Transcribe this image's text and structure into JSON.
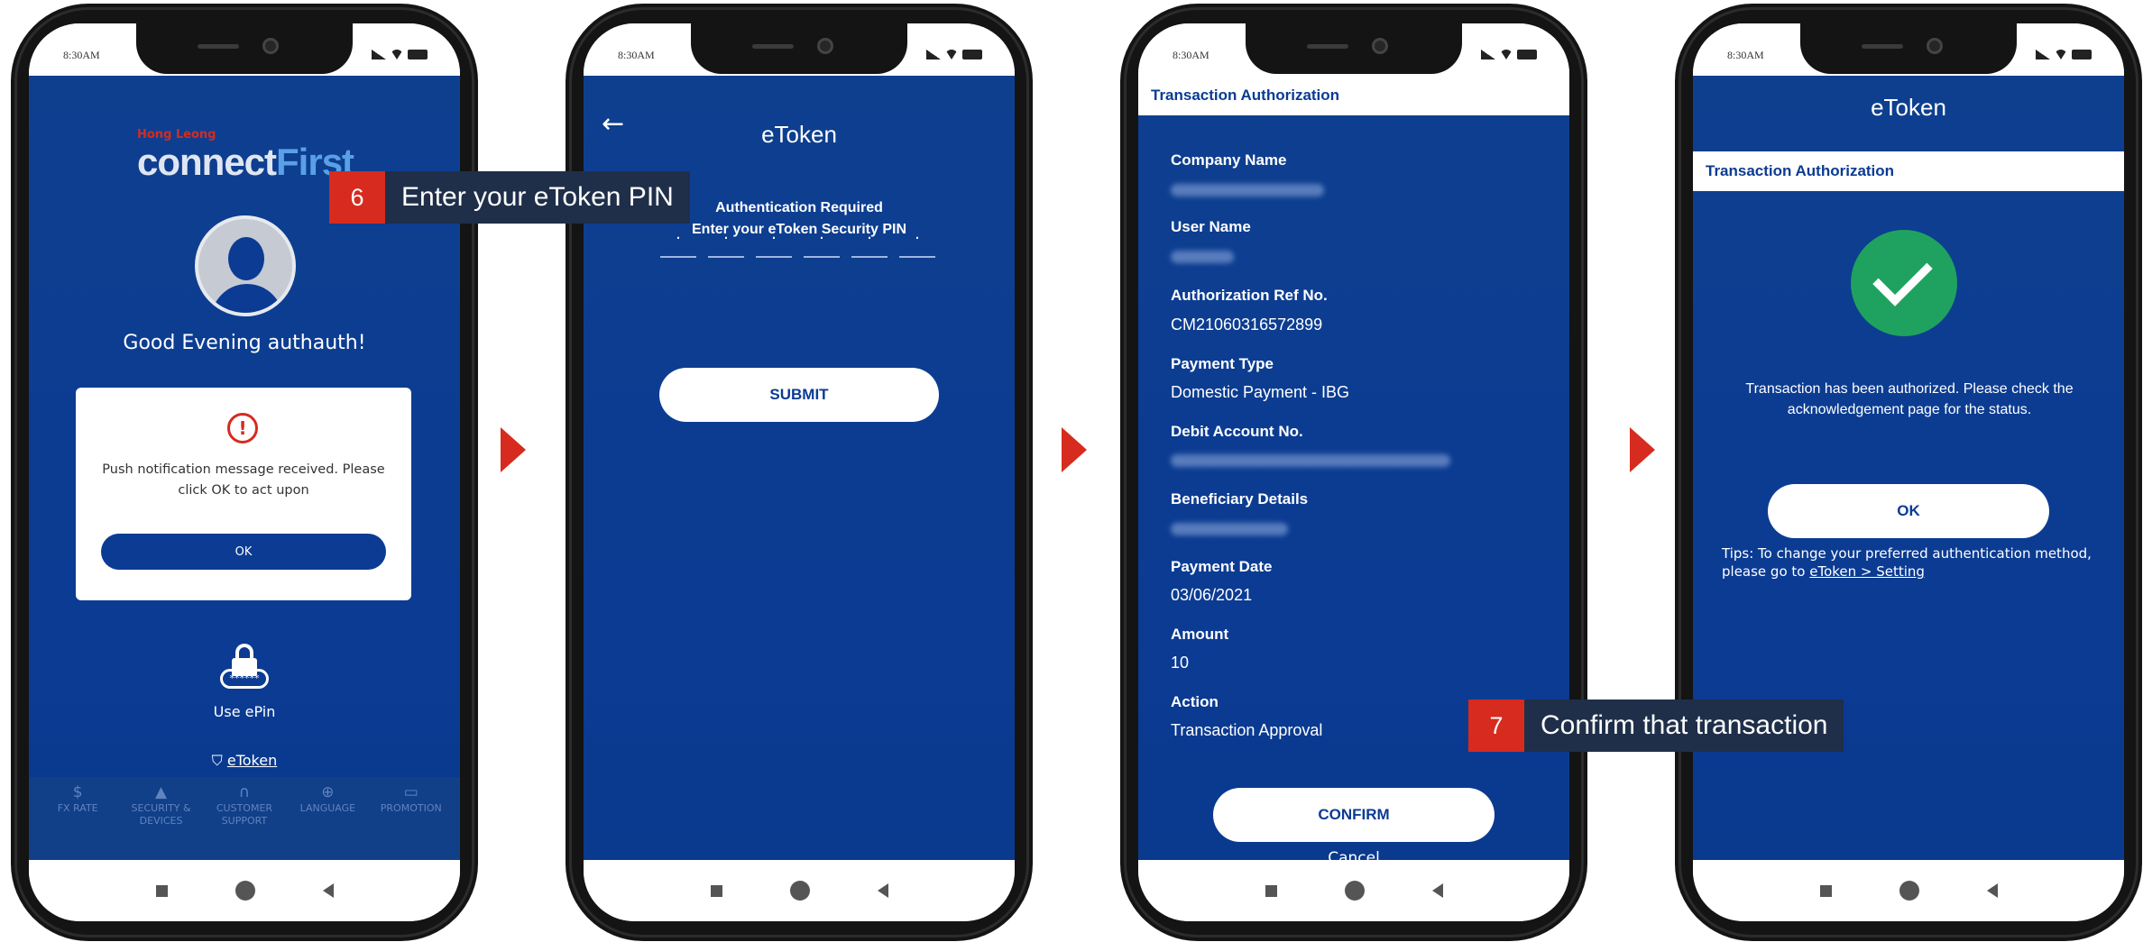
{
  "status_time": "8:30AM",
  "callouts": {
    "step6": {
      "num": "6",
      "text": "Enter your eToken PIN"
    },
    "step7": {
      "num": "7",
      "text": "Confirm that transaction"
    }
  },
  "screen1": {
    "brand_small": "Hong Leong",
    "brand_connect": "connect",
    "brand_first": "First",
    "greeting": "Good Evening authauth!",
    "dialog_message": "Push notification message received. Please click OK to act upon",
    "dialog_ok": "OK",
    "use_epin": "Use ePin",
    "etoken_link": "eToken",
    "footer": [
      {
        "icon": "$",
        "label": "FX RATE"
      },
      {
        "icon": "lock-icon",
        "label": "SECURITY & DEVICES"
      },
      {
        "icon": "headset-icon",
        "label": "CUSTOMER SUPPORT"
      },
      {
        "icon": "globe-icon",
        "label": "LANGUAGE"
      },
      {
        "icon": "promo-icon",
        "label": "PROMOTION"
      }
    ]
  },
  "screen2": {
    "title": "eToken",
    "auth_required": "Authentication Required",
    "enter_pin": "Enter your eToken Security PIN",
    "submit": "SUBMIT"
  },
  "screen3": {
    "header": "Transaction Authorization",
    "company_name_label": "Company Name",
    "user_name_label": "User Name",
    "auth_ref_label": "Authorization Ref No.",
    "auth_ref_value": "CM21060316572899",
    "payment_type_label": "Payment Type",
    "payment_type_value": "Domestic Payment - IBG",
    "debit_account_label": "Debit Account No.",
    "beneficiary_label": "Beneficiary Details",
    "payment_date_label": "Payment Date",
    "payment_date_value": "03/06/2021",
    "amount_label": "Amount",
    "amount_value": "10",
    "action_label": "Action",
    "action_value": "Transaction Approval",
    "confirm": "CONFIRM",
    "cancel": "Cancel"
  },
  "screen4": {
    "title": "eToken",
    "header": "Transaction Authorization",
    "message": "Transaction has been authorized. Please check the acknowledgement page for the status.",
    "ok": "OK",
    "tips_text": "Tips: To change your preferred authentication method, please go to",
    "tips_link": "eToken > Setting"
  },
  "colors": {
    "brand_blue": "#0b3b93",
    "accent_red": "#d62b1e",
    "success_green": "#1fa25f"
  }
}
